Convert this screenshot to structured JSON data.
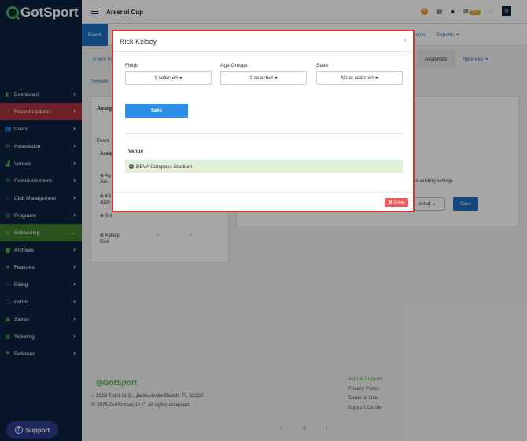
{
  "app": {
    "logo": "GotSport",
    "title": "Arsenal Cup"
  },
  "topbar": {
    "badge": "99+"
  },
  "sidebar": {
    "items": [
      {
        "label": "Dashboard",
        "icon": "dashboard-icon",
        "glyph": "◧"
      },
      {
        "label": "Recent Updates",
        "icon": "history-icon",
        "glyph": "↺"
      },
      {
        "label": "Users",
        "icon": "users-icon",
        "glyph": "👥"
      },
      {
        "label": "Association",
        "icon": "association-icon",
        "glyph": "⁂"
      },
      {
        "label": "Venues",
        "icon": "venues-icon",
        "glyph": "▟"
      },
      {
        "label": "Communications",
        "icon": "communications-icon",
        "glyph": "✉"
      },
      {
        "label": "Club Management",
        "icon": "club-management-icon",
        "glyph": "⌂"
      },
      {
        "label": "Programs",
        "icon": "programs-icon",
        "glyph": "▤"
      },
      {
        "label": "Scheduling",
        "icon": "scheduling-icon",
        "glyph": "▦"
      },
      {
        "label": "Archives",
        "icon": "archives-icon",
        "glyph": "▆"
      },
      {
        "label": "Features",
        "icon": "features-icon",
        "glyph": "★"
      },
      {
        "label": "Billing",
        "icon": "billing-icon",
        "glyph": "▭"
      },
      {
        "label": "Forms",
        "icon": "forms-icon",
        "glyph": "▢"
      },
      {
        "label": "Stores",
        "icon": "stores-icon",
        "glyph": "▣"
      },
      {
        "label": "Ticketing",
        "icon": "ticketing-icon",
        "glyph": "▩"
      },
      {
        "label": "Referees",
        "icon": "referees-icon",
        "glyph": "⚑"
      }
    ],
    "support_label": "Support"
  },
  "background": {
    "tabs": {
      "event": "Event",
      "fields": "ields",
      "exports": "Exports"
    },
    "subtabs": {
      "event_info": "Event In",
      "assignors": "Assignors",
      "referees": "Referees"
    },
    "crumb": "Competiti",
    "panel_title": "Assig",
    "event_label": "Event",
    "assign_label": "Assig",
    "rows": [
      "Ag",
      "Joe",
      "Ka",
      "Josh",
      "Scl",
      "Kelsey,",
      "Rick"
    ],
    "note": "rite their existing settings.",
    "select_partial": "ected",
    "save_label": "Save"
  },
  "modal": {
    "title": "Rick Kelsey",
    "close": "×",
    "fields_label": "Fields",
    "fields_value": "1 selected",
    "age_groups_label": "Age Groups",
    "age_groups_value": "1 selected",
    "state_label": "State",
    "state_value": "None selected",
    "save_label": "Save",
    "venue_header": "Venue",
    "venue_item": "BBVA Compass Stadium",
    "delete_label": "Delete"
  },
  "footer": {
    "logo": "GotSport",
    "address": "1529 Third St S., Jacksonville Beach, FL 32250",
    "copyright": "© 2025 GotSoccer, LLC. All rights reserved.",
    "help_support": "Help & Support",
    "privacy": "Privacy Policy",
    "terms": "Terms of Use",
    "support_center": "Support Center",
    "social": [
      "f",
      "◎",
      "t"
    ]
  },
  "colors": {
    "accent": "#1a6fc4",
    "brand_green": "#4caf50",
    "sidebar_bg": "#0f2241",
    "highlight_red": "#e03131"
  }
}
